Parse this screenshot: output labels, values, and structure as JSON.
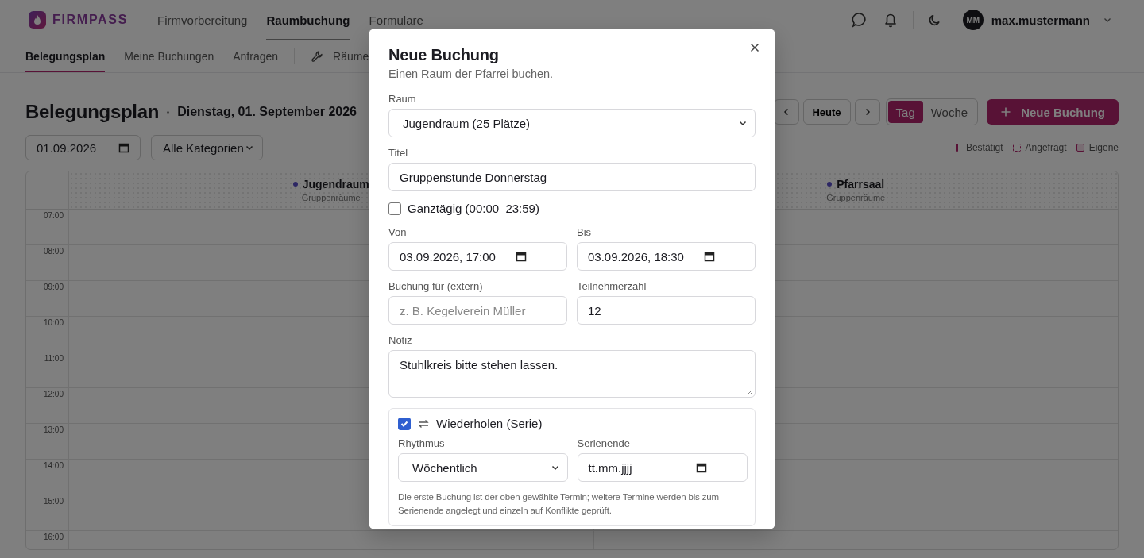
{
  "header": {
    "brand": "FIRMPASS",
    "nav": [
      {
        "label": "Firmvorbereitung",
        "selected": false
      },
      {
        "label": "Raumbuchung",
        "selected": true
      },
      {
        "label": "Formulare",
        "selected": false
      }
    ],
    "avatar_initials": "MM",
    "username": "max.mustermann"
  },
  "subnav": {
    "tabs": [
      {
        "label": "Belegungsplan",
        "selected": true
      },
      {
        "label": "Meine Buchungen",
        "selected": false
      },
      {
        "label": "Anfragen",
        "selected": false
      }
    ],
    "admin_tabs": [
      {
        "label": "Räume",
        "selected": false
      }
    ]
  },
  "toolbar": {
    "title": "Belegungsplan",
    "date": "Dienstag, 01. September 2026",
    "date_value": "01.09.2026",
    "category": "Alle Kategorien",
    "today_label": "Heute",
    "views": [
      {
        "label": "Tag",
        "selected": true
      },
      {
        "label": "Woche",
        "selected": false
      }
    ],
    "new_button": "Neue Buchung",
    "legend": [
      {
        "label": "Bestätigt",
        "kind": "solid"
      },
      {
        "label": "Angefragt",
        "kind": "dashed"
      },
      {
        "label": "Eigene",
        "kind": "own"
      }
    ]
  },
  "calendar": {
    "rooms": [
      {
        "name": "Jugendraum",
        "category": "Gruppenräume"
      },
      {
        "name": "Pfarrsaal",
        "category": "Gruppenräume"
      }
    ],
    "hours": [
      "07:00",
      "08:00",
      "09:00",
      "10:00",
      "11:00",
      "12:00",
      "13:00",
      "14:00",
      "15:00",
      "16:00"
    ]
  },
  "dialog": {
    "title": "Neue Buchung",
    "subtitle": "Einen Raum der Pfarrei buchen.",
    "room_label": "Raum",
    "room_value": "Jugendraum (25 Plätze)",
    "title_label": "Titel",
    "title_value": "Gruppenstunde Donnerstag",
    "all_day": {
      "label": "Ganztägig (00:00–23:59)",
      "checked": false
    },
    "from_label": "Von",
    "from_value": "03.09.2026, 17:00",
    "to_label": "Bis",
    "to_value": "03.09.2026, 18:30",
    "extern_label": "Buchung für (extern)",
    "extern_placeholder": "z. B. Kegelverein Müller",
    "participants_label": "Teilnehmerzahl",
    "participants_value": "12",
    "note_label": "Notiz",
    "note_value": "Stuhlkreis bitte stehen lassen.",
    "repeat": {
      "label": "Wiederholen (Serie)",
      "checked": true,
      "rhythm_label": "Rhythmus",
      "rhythm_value": "Wöchentlich",
      "end_label": "Serienende",
      "end_placeholder": "tt.mm.jjjj",
      "hint": "Die erste Buchung ist der oben gewählte Termin; weitere Termine werden bis zum Serienende angelegt und einzeln auf Konflikte geprüft."
    }
  }
}
